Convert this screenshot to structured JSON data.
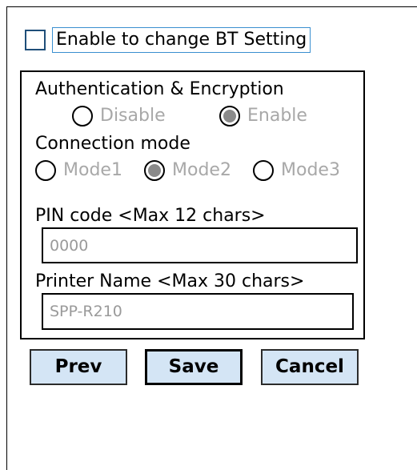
{
  "enable_setting": {
    "label": "Enable to change BT Setting",
    "checked": false
  },
  "authentication": {
    "label": "Authentication & Encryption",
    "options": [
      {
        "label": "Disable",
        "selected": false
      },
      {
        "label": "Enable",
        "selected": true
      }
    ]
  },
  "connection_mode": {
    "label": "Connection mode",
    "options": [
      {
        "label": "Mode1",
        "selected": false
      },
      {
        "label": "Mode2",
        "selected": true
      },
      {
        "label": "Mode3",
        "selected": false
      }
    ]
  },
  "pin_code": {
    "label": "PIN code <Max 12 chars>",
    "value": "0000"
  },
  "printer_name": {
    "label": "Printer Name <Max 30 chars>",
    "value": "SPP-R210"
  },
  "buttons": {
    "prev": "Prev",
    "save": "Save",
    "cancel": "Cancel"
  },
  "colors": {
    "button_bg": "#d4e5f5",
    "disabled_text": "#a8a8a8",
    "checkbox_border": "#1f4e79",
    "focus_border": "#3a8fd0"
  }
}
